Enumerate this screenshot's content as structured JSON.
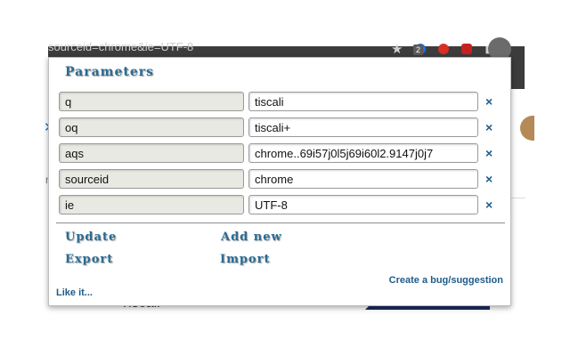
{
  "background": {
    "tab_title": "sourceid=chrome&ie=UTF-8",
    "badge_count": "2",
    "result_text": "Tiscali"
  },
  "popup": {
    "heading": "Parameters",
    "params": [
      {
        "key": "q",
        "value": "tiscali"
      },
      {
        "key": "oq",
        "value": "tiscali+"
      },
      {
        "key": "aqs",
        "value": "chrome..69i57j0l5j69i60l2.9147j0j7"
      },
      {
        "key": "sourceid",
        "value": "chrome"
      },
      {
        "key": "ie",
        "value": "UTF-8"
      }
    ],
    "delete_symbol": "×",
    "actions": {
      "update": "Update",
      "add_new": "Add new",
      "export": "Export",
      "import": "Import"
    },
    "bug_link": "Create a bug/suggestion",
    "like_link": "Like it..."
  },
  "colors": {
    "accent": "#2a6c94",
    "link": "#1e5c8a",
    "key_bg": "#e9e9e4"
  }
}
